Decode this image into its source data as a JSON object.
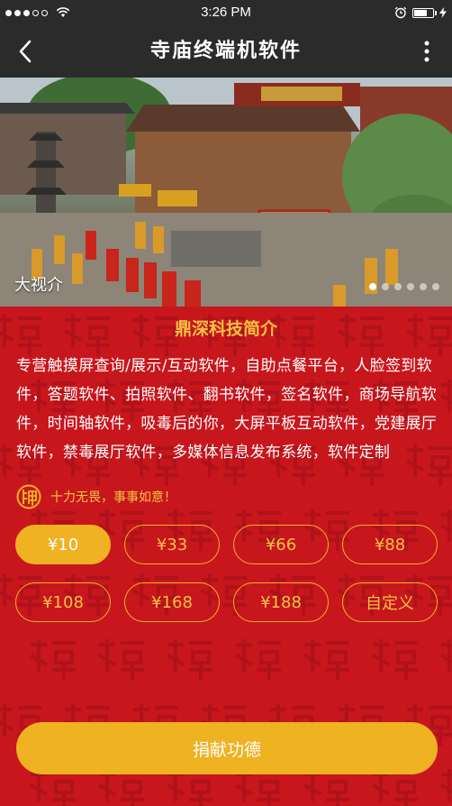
{
  "status_bar": {
    "time": "3:26 PM",
    "signal_icon": "signal-dots-icon",
    "wifi_icon": "wifi-icon",
    "alarm_icon": "alarm-clock-icon",
    "battery_icon": "battery-icon",
    "charging_icon": "charging-bolt-icon"
  },
  "nav": {
    "title": "寺庙终端机软件",
    "back_icon": "chevron-left-icon",
    "more_icon": "more-vertical-icon"
  },
  "banner": {
    "caption": "大视介",
    "dots_count": 6,
    "active_dot": 0
  },
  "intro": {
    "title": "鼎深科技简介",
    "text": "专营触摸屏查询/展示/互动软件，自助点餐平台，人脸签到软件，答题软件、拍照软件、翻书软件，签名软件，商场导航软件，时间轴软件，吸毒后的你，大屏平板互动软件，党建展厅软件，禁毒展厅软件，多媒体信息发布系统，软件定制"
  },
  "blessing": {
    "icon": "buddha-seal-icon",
    "text": "十力无畏，事事如意！"
  },
  "amounts": {
    "items": [
      "¥10",
      "¥33",
      "¥66",
      "¥88",
      "¥108",
      "¥168",
      "¥188",
      "自定义"
    ],
    "selected_index": 0
  },
  "donate_button": {
    "label": "捐献功德"
  },
  "colors": {
    "background_red": "#c8161d",
    "gold": "#eeb222",
    "gold_text": "#f5c242",
    "bar_dark": "#2b2b2b"
  }
}
